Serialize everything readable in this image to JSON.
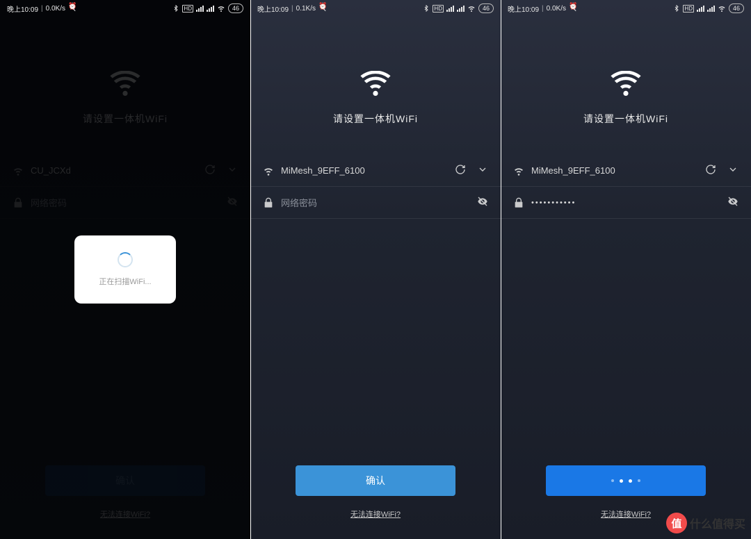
{
  "status": {
    "time": "晚上10:09",
    "speed1": "0.0K/s",
    "speed2": "0.1K/s",
    "speed3": "0.0K/s",
    "battery": "46"
  },
  "screen1": {
    "title": "请设置一体机WiFi",
    "wifi_name": "CU_JCXd",
    "password_placeholder": "网络密码",
    "confirm": "确认",
    "help": "无法连接WiFi?",
    "modal_text": "正在扫描WiFi..."
  },
  "screen2": {
    "title": "请设置一体机WiFi",
    "wifi_name": "MiMesh_9EFF_6100",
    "password_placeholder": "网络密码",
    "confirm": "确认",
    "help": "无法连接WiFi?"
  },
  "screen3": {
    "title": "请设置一体机WiFi",
    "wifi_name": "MiMesh_9EFF_6100",
    "password_value": "•••••••••••",
    "help": "无法连接WiFi?"
  },
  "watermark": {
    "badge": "值",
    "text": "什么值得买"
  }
}
